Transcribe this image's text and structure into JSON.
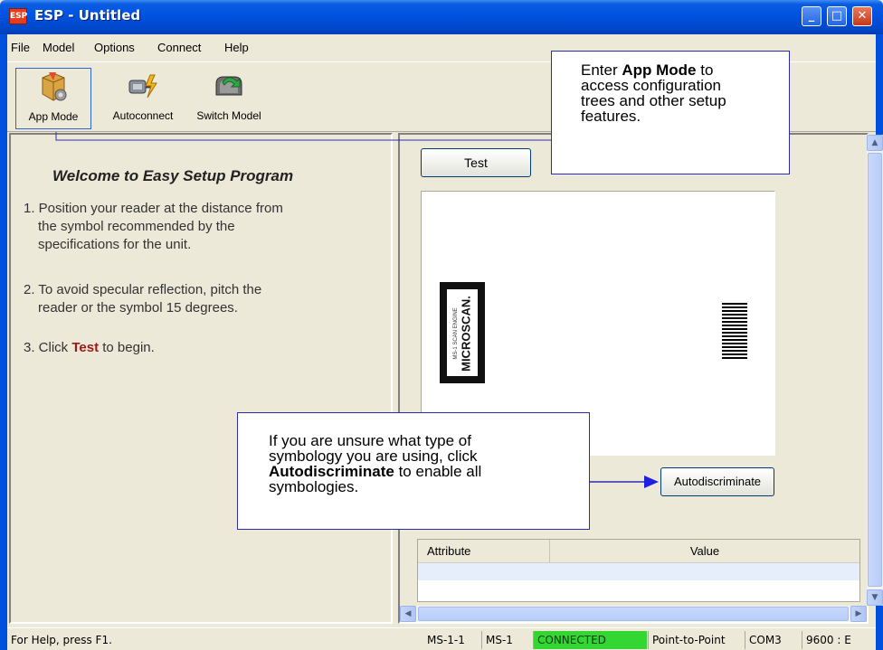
{
  "window": {
    "title": "ESP - Untitled",
    "app_icon_text": "ESP",
    "controls": {
      "minimize": "_",
      "maximize": "□",
      "close": "✕"
    }
  },
  "menu": {
    "items": [
      "File",
      "Model",
      "Options",
      "Connect",
      "Help"
    ]
  },
  "toolbar": {
    "app_mode": "App Mode",
    "autoconnect": "Autoconnect",
    "switch_model": "Switch Model"
  },
  "left_pane": {
    "title": "Welcome to Easy Setup Program",
    "step1_line1": "1. Position your reader at the distance from",
    "step1_line2": "the symbol recommended by the",
    "step1_line3": "specifications for the unit.",
    "step2_line1": "2. To avoid specular reflection, pitch the",
    "step2_line2": "reader or the symbol 15 degrees.",
    "step3_prefix": "3. Click ",
    "step3_bold": "Test",
    "step3_suffix": " to begin."
  },
  "right_pane": {
    "test_button": "Test",
    "scanner_brand": "MICROSCAN.",
    "scanner_sub": "MS-1 SCAN ENGINE",
    "autodiscriminate_button": "Autodiscriminate",
    "table": {
      "col_attribute": "Attribute",
      "col_value": "Value"
    }
  },
  "callouts": {
    "app_mode": {
      "line1_prefix": "Enter ",
      "line1_bold": "App Mode",
      "line1_suffix": " to",
      "line2": "access configuration",
      "line3": "trees and other setup",
      "line4": "features."
    },
    "autodisc": {
      "line1": "If you are unsure what type of",
      "line2": "symbology you are using, click",
      "line3_bold": "Autodiscriminate",
      "line3_suffix": " to enable all",
      "line4": "symbologies."
    }
  },
  "statusbar": {
    "help": "For Help, press F1.",
    "model1": "MS-1-1",
    "model2": "MS-1",
    "connection": "CONNECTED",
    "mode": "Point-to-Point",
    "port": "COM3",
    "baud": "9600 : E"
  },
  "colors": {
    "titlebar": "#0054E3",
    "connected": "#33D633",
    "callout_border": "#2B2BB8",
    "step_highlight": "#9A1A1A"
  }
}
